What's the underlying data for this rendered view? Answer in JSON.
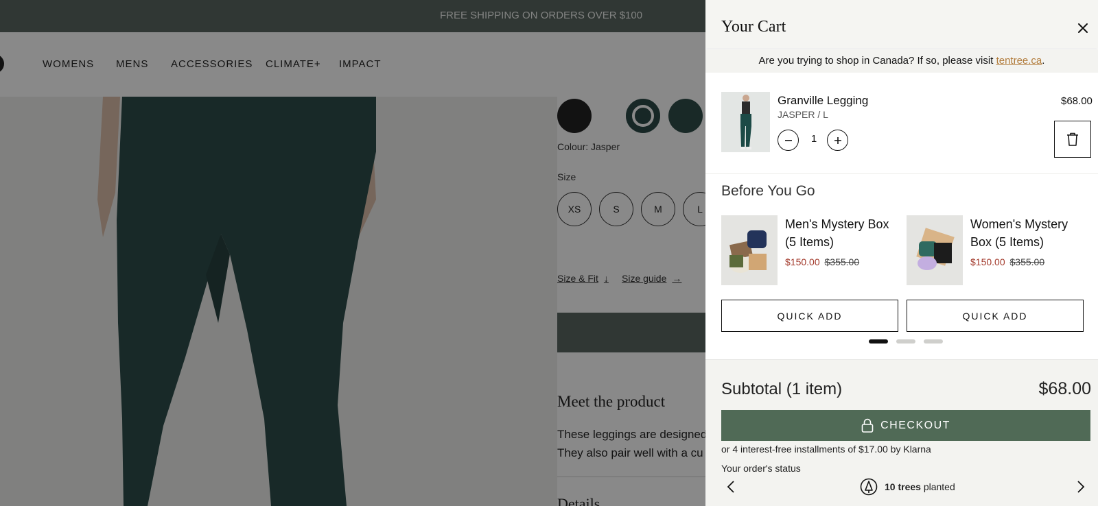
{
  "promo": {
    "text": "FREE SHIPPING ON ORDERS OVER $100"
  },
  "nav": {
    "items": [
      "WOMENS",
      "MENS",
      "ACCESSORIES",
      "CLIMATE+",
      "IMPACT"
    ]
  },
  "product": {
    "colour_label": "Colour: Jasper",
    "size_label": "Size",
    "sizes": [
      "XS",
      "S",
      "M",
      "L"
    ],
    "size_fit_link": "Size & Fit",
    "size_guide_link": "Size guide",
    "meet_title": "Meet the product",
    "meet_lines": [
      "These leggings are designed",
      "They also pair well with a cu"
    ],
    "details_title": "Details"
  },
  "cart": {
    "title": "Your Cart",
    "canada_prefix": "Are you trying to shop in Canada? If so, please visit ",
    "canada_link": "tentree.ca",
    "canada_suffix": ".",
    "item": {
      "name": "Granville Legging",
      "variant": "JASPER / L",
      "price": "$68.00",
      "quantity": "1"
    },
    "upsell_title": "Before You Go",
    "upsells": [
      {
        "name": "Men's Mystery Box (5 Items)",
        "sale_price": "$150.00",
        "original_price": "$355.00",
        "button": "QUICK ADD"
      },
      {
        "name": "Women's Mystery Box (5 Items)",
        "sale_price": "$150.00",
        "original_price": "$355.00",
        "button": "QUICK ADD"
      }
    ],
    "subtotal_label": "Subtotal (1 item)",
    "subtotal_value": "$68.00",
    "checkout_label": "CHECKOUT",
    "klarna": "or 4 interest-free installments of $17.00 by Klarna",
    "status_label": "Your order's status",
    "trees_count": "10 trees",
    "trees_suffix": "planted"
  },
  "colors": {
    "accent_green": "#506a56",
    "sale_red": "#a33a2c",
    "link_gold": "#b27c3c",
    "promo_bar": "#4c5a54"
  },
  "icons": [
    "close-icon",
    "minus-icon",
    "plus-icon",
    "trash-icon",
    "lock-icon",
    "tree-icon",
    "chevron-left-icon",
    "chevron-right-icon",
    "arrow-down-icon",
    "arrow-right-icon"
  ]
}
